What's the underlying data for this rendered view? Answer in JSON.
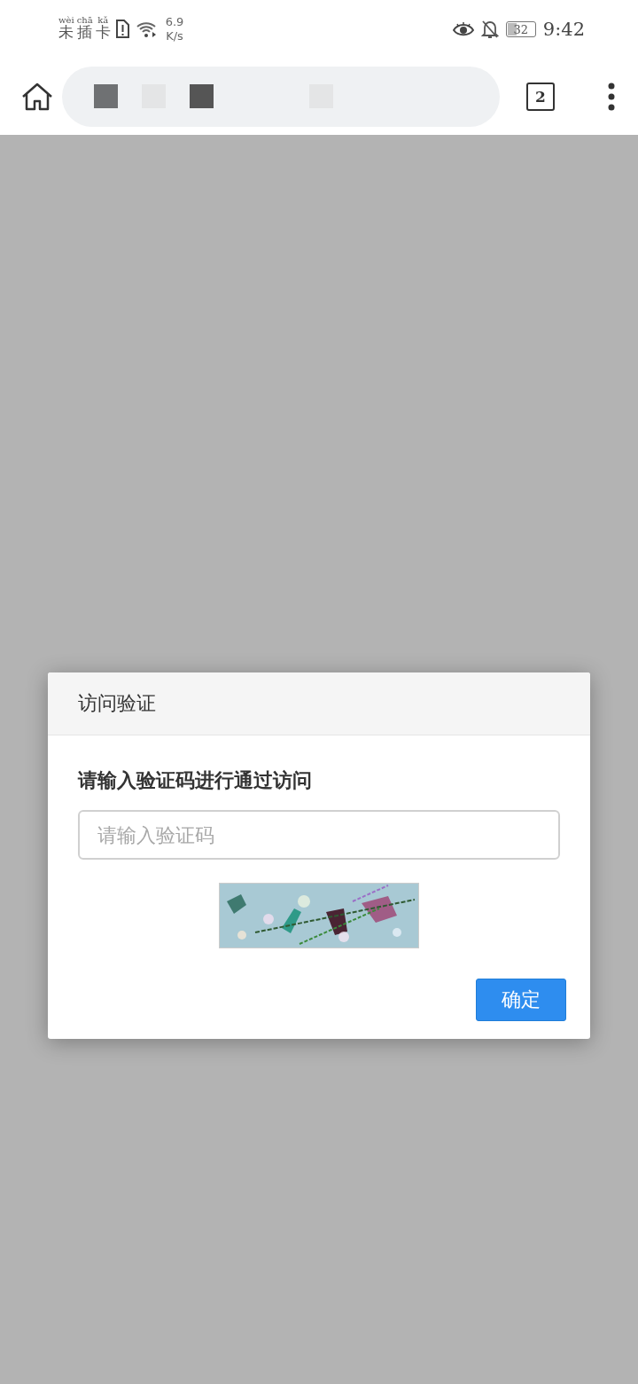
{
  "status_bar": {
    "sim_status": [
      {
        "char": "未",
        "pinyin": "wèi"
      },
      {
        "char": "插",
        "pinyin": "chā"
      },
      {
        "char": "卡",
        "pinyin": "kǎ"
      }
    ],
    "speed_value": "6.9",
    "speed_unit": "K/s",
    "battery": "32",
    "time": "9:42"
  },
  "toolbar": {
    "tab_count": "2"
  },
  "dialog": {
    "title": "访问验证",
    "prompt": "请输入验证码进行通过访问",
    "input": {
      "placeholder": "请输入验证码"
    },
    "confirm_button": "确定"
  }
}
